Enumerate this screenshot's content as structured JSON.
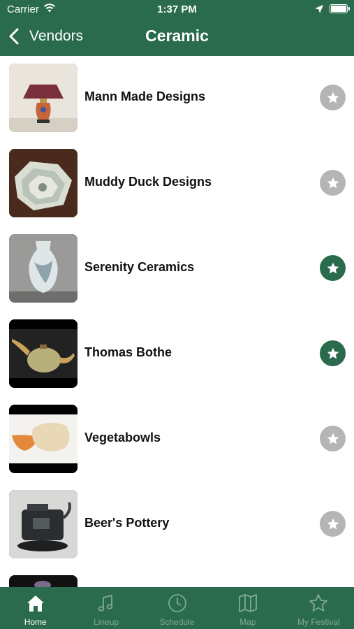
{
  "status_bar": {
    "carrier": "Carrier",
    "time": "1:37 PM"
  },
  "nav": {
    "back_label": "Vendors",
    "title": "Ceramic"
  },
  "vendors": [
    {
      "name": "Mann Made Designs",
      "favorited": false,
      "thumb_icon": "lamp-photo"
    },
    {
      "name": "Muddy Duck Designs",
      "favorited": false,
      "thumb_icon": "stacked-plates-photo"
    },
    {
      "name": "Serenity Ceramics",
      "favorited": true,
      "thumb_icon": "vase-photo"
    },
    {
      "name": "Thomas Bothe",
      "favorited": true,
      "thumb_icon": "teapot-photo"
    },
    {
      "name": "Vegetabowls",
      "favorited": false,
      "thumb_icon": "bowls-photo"
    },
    {
      "name": "Beer's Pottery",
      "favorited": false,
      "thumb_icon": "kettle-sculpture-photo"
    },
    {
      "name": "",
      "favorited": false,
      "thumb_icon": "partial-photo"
    }
  ],
  "tabs": [
    {
      "label": "Home",
      "icon": "home-icon",
      "active": true
    },
    {
      "label": "Lineup",
      "icon": "music-note-icon",
      "active": false
    },
    {
      "label": "Schedule",
      "icon": "clock-icon",
      "active": false
    },
    {
      "label": "Map",
      "icon": "map-icon",
      "active": false
    },
    {
      "label": "My Festival",
      "icon": "star-outline-icon",
      "active": false
    }
  ],
  "colors": {
    "brand_green": "#2a6b4d",
    "star_off": "#b5b5b5",
    "tab_inactive": "#7fa896"
  }
}
